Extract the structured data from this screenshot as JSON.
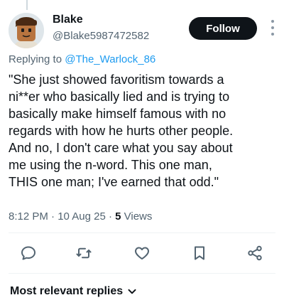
{
  "author": {
    "display_name": "Blake",
    "handle": "@Blake5987472582"
  },
  "follow_label": "Follow",
  "reply_context": {
    "prefix": "Replying to ",
    "mention": "@The_Warlock_86"
  },
  "tweet_text": "\"She just showed favoritism towards a\nni**er who basically lied and is trying to\nbasically make himself famous with no\nregards with how he hurts other people.\nAnd no, I don't care what you say about\nme using the n-word. This one man,\nTHIS one man; I've earned that odd.\"",
  "meta": {
    "time": "8:12 PM",
    "sep1": " · ",
    "date": "10 Aug 25",
    "sep2": " · ",
    "views_count": "5",
    "views_label": " Views"
  },
  "actions": [
    "reply-icon",
    "retweet-icon",
    "like-icon",
    "bookmark-icon",
    "share-icon"
  ],
  "replies_sort_label": "Most relevant replies",
  "colors": {
    "text": "#0f1419",
    "secondary": "#536471",
    "link": "#1d9bf0",
    "divider": "#eff3f4"
  }
}
